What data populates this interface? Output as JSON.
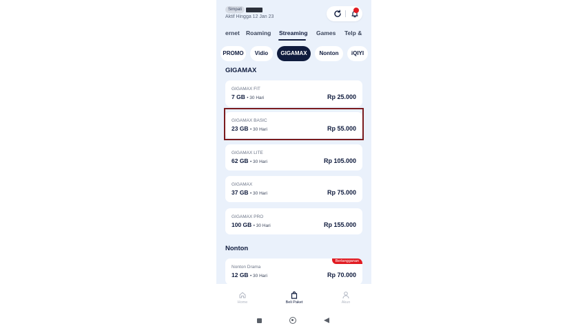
{
  "header": {
    "sim_label": "Simpati",
    "active_until": "Aktif Hingga 12 Jan 23"
  },
  "category_tabs": [
    "ernet",
    "Roaming",
    "Streaming",
    "Games",
    "Telp &"
  ],
  "active_category": "Streaming",
  "chips": [
    "PROMO",
    "Vidio",
    "GIGAMAX",
    "Nonton",
    "iQIYI"
  ],
  "active_chip": "GIGAMAX",
  "sections": [
    {
      "title": "GIGAMAX",
      "packages": [
        {
          "name": "GIGAMAX FIT",
          "quota": "7 GB",
          "duration": "• 30 Hari",
          "price": "Rp 25.000"
        },
        {
          "name": "GIGAMAX BASIC",
          "quota": "23 GB",
          "duration": "• 30 Hari",
          "price": "Rp 55.000"
        },
        {
          "name": "GIGAMAX LITE",
          "quota": "62 GB",
          "duration": "• 30 Hari",
          "price": "Rp 105.000"
        },
        {
          "name": "GIGAMAX",
          "quota": "37 GB",
          "duration": "• 30 Hari",
          "price": "Rp 75.000"
        },
        {
          "name": "GIGAMAX PRO",
          "quota": "100 GB",
          "duration": "• 30 Hari",
          "price": "Rp 155.000"
        }
      ]
    },
    {
      "title": "Nonton",
      "packages": [
        {
          "name": "Nonton Drama",
          "quota": "12 GB",
          "duration": "• 30 Hari",
          "price": "Rp 70.000",
          "badge": "Berlangganan"
        }
      ]
    }
  ],
  "bottom_nav": [
    {
      "label": "Home",
      "icon": "home-icon"
    },
    {
      "label": "Beli Paket",
      "icon": "shopping-bag-icon"
    },
    {
      "label": "Akun",
      "icon": "user-icon"
    }
  ],
  "active_nav": "Beli Paket",
  "colors": {
    "primary": "#0f1b3d",
    "background": "#eaf1fb",
    "badge_red": "#e11b22",
    "highlight": "#7a1a1d"
  }
}
